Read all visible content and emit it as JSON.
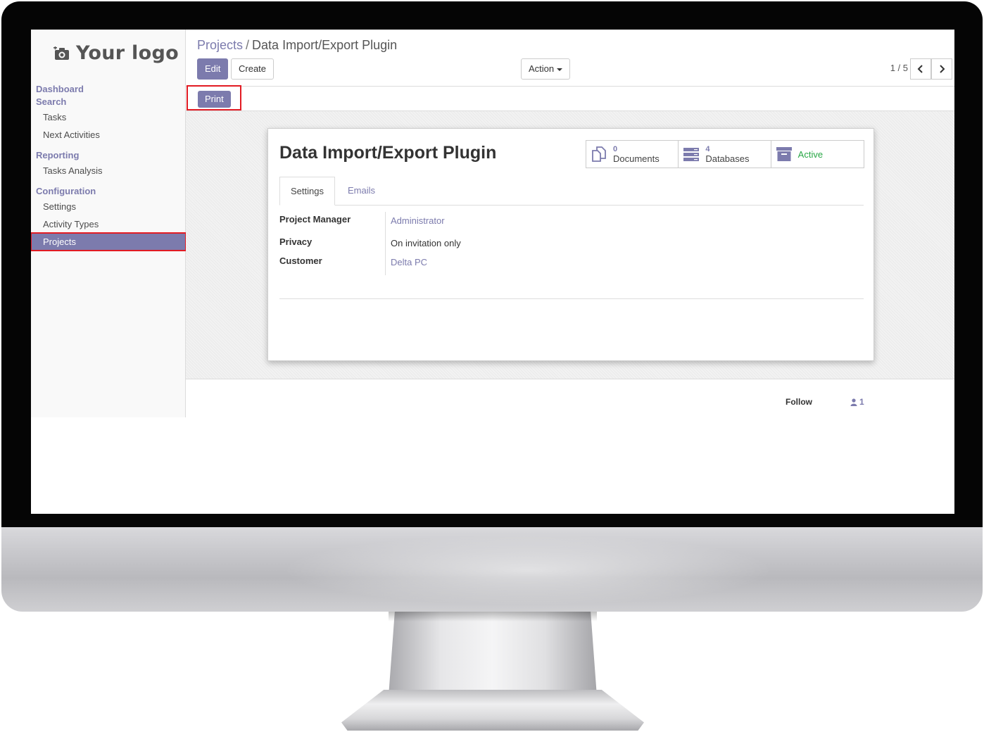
{
  "logo": {
    "text": "Your logo"
  },
  "sidebar": {
    "sections": [
      {
        "label": "Dashboard"
      },
      {
        "label": "Search",
        "items": [
          "Tasks",
          "Next Activities"
        ]
      },
      {
        "label": "Reporting",
        "items": [
          "Tasks Analysis"
        ]
      },
      {
        "label": "Configuration",
        "items": [
          "Settings",
          "Activity Types",
          "Projects"
        ]
      }
    ],
    "active_item": "Projects"
  },
  "breadcrumb": {
    "parent": "Projects",
    "separator": "/",
    "current": "Data Import/Export Plugin"
  },
  "toolbar": {
    "edit_label": "Edit",
    "create_label": "Create",
    "action_label": "Action"
  },
  "pager": {
    "value": "1 / 5"
  },
  "statusbar": {
    "print_label": "Print"
  },
  "record": {
    "title": "Data Import/Export Plugin",
    "smart_buttons": {
      "documents": {
        "count": "0",
        "label": "Documents"
      },
      "databases": {
        "count": "4",
        "label": "Databases"
      },
      "active": {
        "label": "Active"
      }
    },
    "tabs": [
      "Settings",
      "Emails"
    ],
    "fields": {
      "project_manager": {
        "label": "Project Manager",
        "value": "Administrator"
      },
      "privacy": {
        "label": "Privacy",
        "value": "On invitation only"
      },
      "customer": {
        "label": "Customer",
        "value": "Delta PC"
      }
    }
  },
  "chatter": {
    "follow_label": "Follow",
    "followers_count": "1"
  },
  "colors": {
    "brand": "#7c7bad",
    "highlight": "#e21b23",
    "active_green": "#28a745"
  }
}
